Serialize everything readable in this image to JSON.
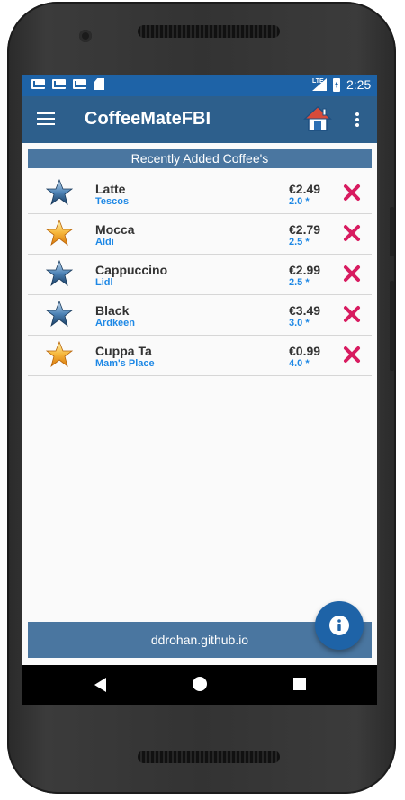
{
  "status_bar": {
    "time": "2:25",
    "network": "LTE",
    "notification_icons": [
      "gmail-icon",
      "gmail-icon",
      "gmail-icon",
      "sd-card-icon"
    ]
  },
  "app_bar": {
    "title": "CoffeeMateFBI",
    "icons": [
      "menu-icon",
      "home-icon",
      "overflow-menu-icon"
    ]
  },
  "list_header": "Recently Added Coffee's",
  "coffees": [
    {
      "name": "Latte",
      "shop": "Tescos",
      "price": "€2.49",
      "rating": "2.0 *",
      "favourite": false
    },
    {
      "name": "Mocca",
      "shop": "Aldi",
      "price": "€2.79",
      "rating": "2.5 *",
      "favourite": true
    },
    {
      "name": "Cappuccino",
      "shop": "Lidl",
      "price": "€2.99",
      "rating": "2.5 *",
      "favourite": false
    },
    {
      "name": "Black",
      "shop": "Ardkeen",
      "price": "€3.49",
      "rating": "3.0 *",
      "favourite": false
    },
    {
      "name": "Cuppa Ta",
      "shop": "Mam's Place",
      "price": "€0.99",
      "rating": "4.0 *",
      "favourite": true
    }
  ],
  "footer": {
    "text": "ddrohan.github.io"
  },
  "colors": {
    "status_bar": "#1e63a7",
    "app_bar": "#2d5f8c",
    "band": "#4a76a0",
    "accent_text": "#1e88e5",
    "delete": "#d81b60"
  }
}
